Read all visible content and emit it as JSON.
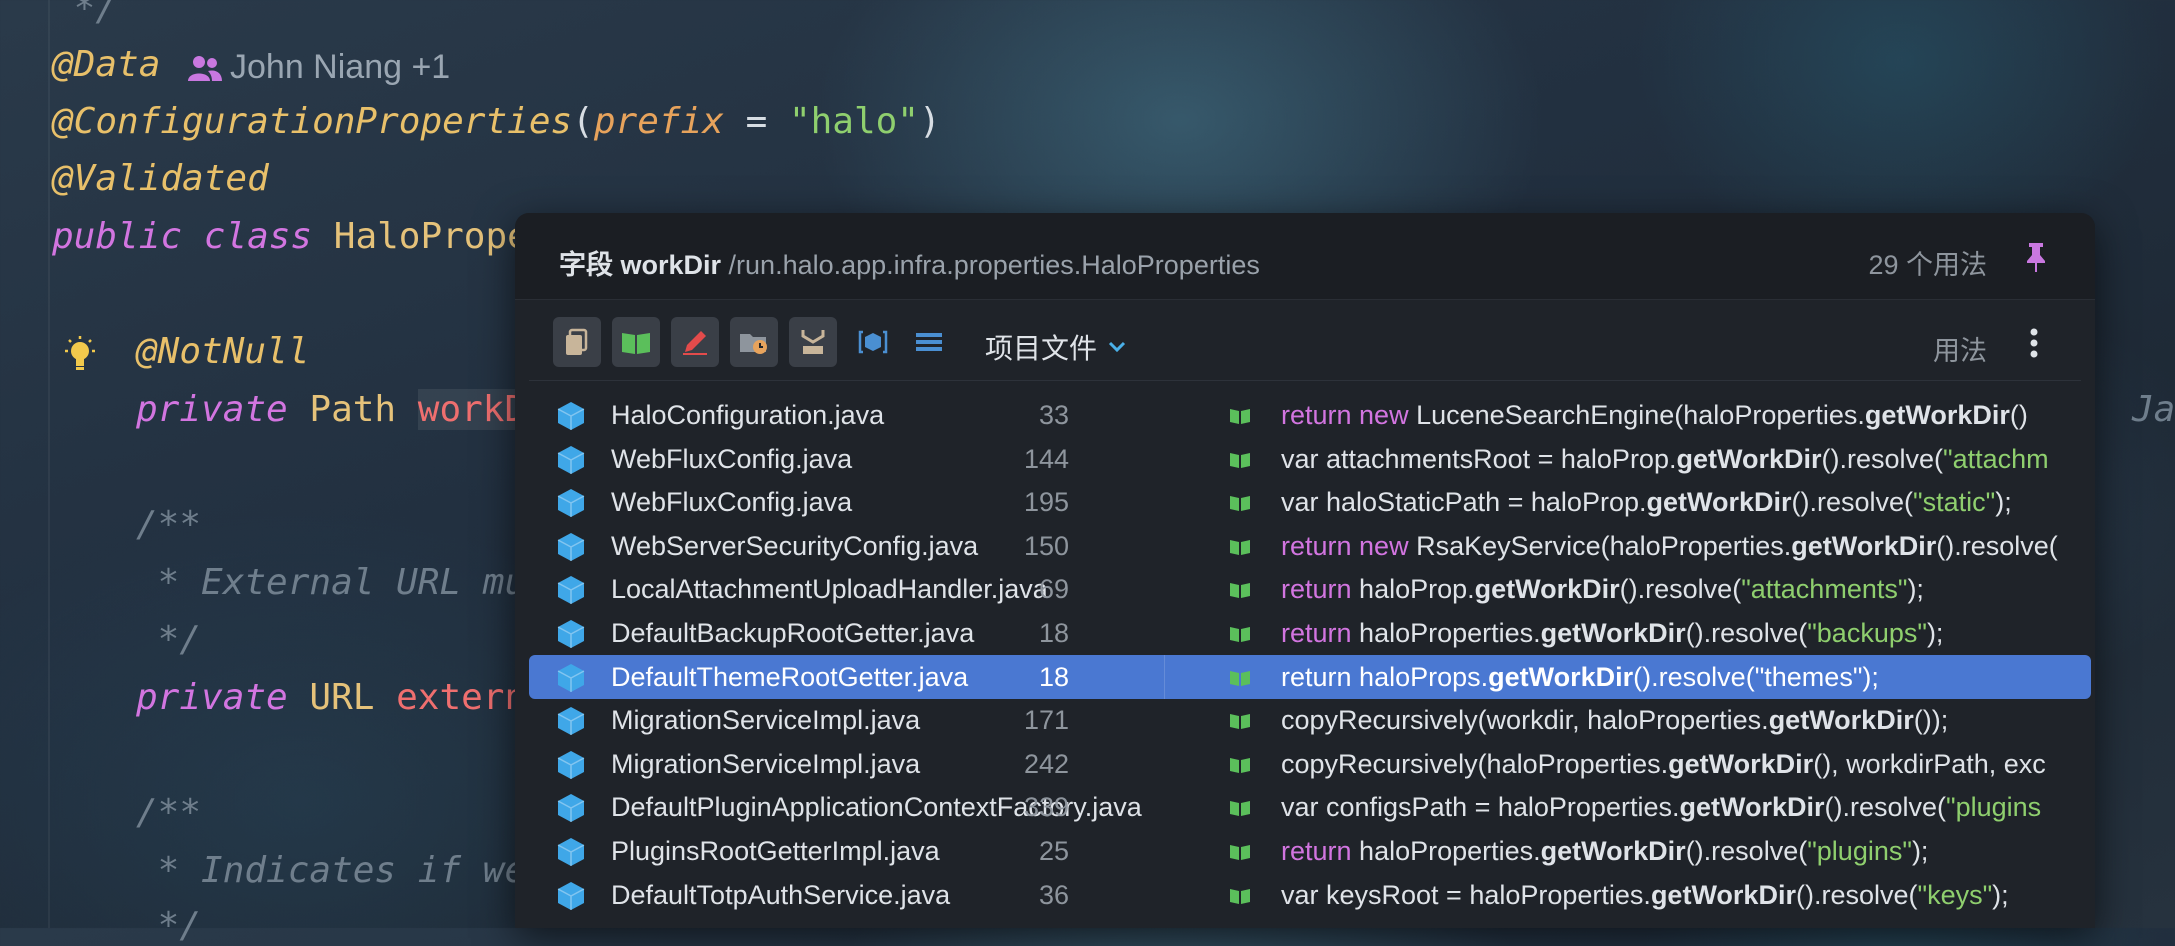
{
  "editor": {
    "lines": {
      "comment_end": " */",
      "anno_data": "@Data",
      "author": "John Niang +1",
      "anno_config": "@ConfigurationProperties",
      "anno_config_paren_open": "(",
      "anno_config_param": "prefix",
      "anno_config_eq": " = ",
      "anno_config_value": "\"halo\"",
      "anno_config_paren_close": ")",
      "anno_validated": "@Validated",
      "class_kw": "public class ",
      "class_name": "HaloPrope",
      "anno_notnull": "@NotNull",
      "field1_kw": "private ",
      "field1_type": "Path ",
      "field1_name": "workD",
      "jar_hint": "Jar",
      "doc1_open": "/**",
      "doc1_text": " * External URL mu",
      "doc1_close": " */",
      "field2_kw": "private ",
      "field2_type": "URL ",
      "field2_name": "extern",
      "doc2_open": "/**",
      "doc2_text": " * Indicates if we",
      "doc2_close": " */"
    }
  },
  "popup": {
    "title_prefix": "字段 ",
    "title_field": "workDir",
    "title_path": " /run.halo.app.infra.properties.HaloProperties",
    "usage_count": "29 个用法",
    "scope_label": "项目文件",
    "usage_label": "用法",
    "rows": [
      {
        "file": "HaloConfiguration.java",
        "line": "33",
        "pre_kw": "",
        "kw": "return new",
        "a": " LuceneSearchEngine(haloProperties.",
        "bold": "getWorkDir",
        "b": "()",
        "str": "",
        "c": ""
      },
      {
        "file": "WebFluxConfig.java",
        "line": "144",
        "pre_kw": "var attachmentsRoot = haloProp.",
        "kw": "",
        "a": "",
        "bold": "getWorkDir",
        "b": "().resolve(",
        "str": "\"attachm",
        "c": ""
      },
      {
        "file": "WebFluxConfig.java",
        "line": "195",
        "pre_kw": "var haloStaticPath = haloProp.",
        "kw": "",
        "a": "",
        "bold": "getWorkDir",
        "b": "().resolve(",
        "str": "\"static\"",
        "c": ");"
      },
      {
        "file": "WebServerSecurityConfig.java",
        "line": "150",
        "pre_kw": "",
        "kw": "return new",
        "a": " RsaKeyService(haloProperties.",
        "bold": "getWorkDir",
        "b": "().resolve(",
        "str": "",
        "c": ""
      },
      {
        "file": "LocalAttachmentUploadHandler.java",
        "line": "69",
        "pre_kw": "",
        "kw": "return",
        "a": " haloProp.",
        "bold": "getWorkDir",
        "b": "().resolve(",
        "str": "\"attachments\"",
        "c": ");"
      },
      {
        "file": "DefaultBackupRootGetter.java",
        "line": "18",
        "pre_kw": "",
        "kw": "return",
        "a": " haloProperties.",
        "bold": "getWorkDir",
        "b": "().resolve(",
        "str": "\"backups\"",
        "c": ");"
      },
      {
        "file": "DefaultThemeRootGetter.java",
        "line": "18",
        "pre_kw": "",
        "kw": "return",
        "a": " haloProps.",
        "bold": "getWorkDir",
        "b": "().resolve(",
        "str": "\"themes\"",
        "c": ");",
        "selected": true
      },
      {
        "file": "MigrationServiceImpl.java",
        "line": "171",
        "pre_kw": "copyRecursively(workdir, haloProperties.",
        "kw": "",
        "a": "",
        "bold": "getWorkDir",
        "b": "());",
        "str": "",
        "c": ""
      },
      {
        "file": "MigrationServiceImpl.java",
        "line": "242",
        "pre_kw": "copyRecursively(haloProperties.",
        "kw": "",
        "a": "",
        "bold": "getWorkDir",
        "b": "(), workdirPath, exc",
        "str": "",
        "c": ""
      },
      {
        "file": "DefaultPluginApplicationContextFactory.java",
        "line": "339",
        "pre_kw": "var configsPath = haloProperties.",
        "kw": "",
        "a": "",
        "bold": "getWorkDir",
        "b": "().resolve(",
        "str": "\"plugins",
        "c": ""
      },
      {
        "file": "PluginsRootGetterImpl.java",
        "line": "25",
        "pre_kw": "",
        "kw": "return",
        "a": " haloProperties.",
        "bold": "getWorkDir",
        "b": "().resolve(",
        "str": "\"plugins\"",
        "c": ");"
      },
      {
        "file": "DefaultTotpAuthService.java",
        "line": "36",
        "pre_kw": "var keysRoot = haloProperties.",
        "kw": "",
        "a": "",
        "bold": "getWorkDir",
        "b": "().resolve(",
        "str": "\"keys\"",
        "c": ");"
      }
    ]
  },
  "colors": {
    "selection": "#4a78d2",
    "keyword": "#d275e0",
    "string": "#8fcf6e",
    "annotation": "#e8c06a",
    "file_icon": "#3fa7e8"
  }
}
